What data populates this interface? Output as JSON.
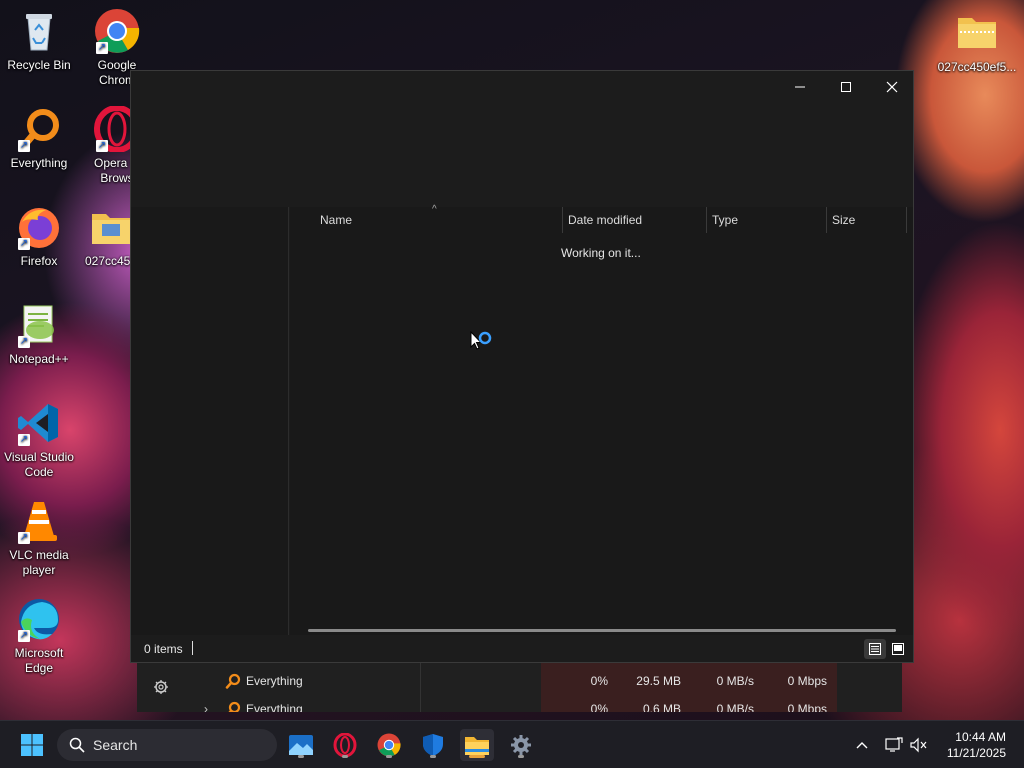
{
  "desktop": {
    "icons": [
      {
        "label": "Recycle Bin",
        "icon": "recycle-bin-icon"
      },
      {
        "label": "Google Chrome",
        "display": "Google\nChrom",
        "icon": "chrome-icon"
      },
      {
        "label": "Everything",
        "icon": "everything-icon"
      },
      {
        "label": "Opera GX Browser",
        "display": "Opera G\nBrows",
        "icon": "opera-icon"
      },
      {
        "label": "Firefox",
        "icon": "firefox-icon"
      },
      {
        "label": "027cc450",
        "display": "027cc450",
        "icon": "folder-icon"
      },
      {
        "label": "Notepad++",
        "icon": "notepadpp-icon"
      },
      {
        "label": "Visual Studio Code",
        "icon": "vscode-icon"
      },
      {
        "label": "VLC media player",
        "icon": "vlc-icon"
      },
      {
        "label": "Microsoft Edge",
        "icon": "edge-icon"
      },
      {
        "label": "027cc450ef5...",
        "icon": "zip-folder-icon"
      }
    ],
    "labels": {
      "recycle": "Recycle Bin",
      "chrome_1": "Google",
      "chrome_2": "Chrom",
      "everything": "Everything",
      "opera_1": "Opera G",
      "opera_2": "Brows",
      "firefox": "Firefox",
      "folder": "027cc450",
      "notepad": "Notepad++",
      "vscode_1": "Visual Studio",
      "vscode_2": "Code",
      "vlc_1": "VLC media",
      "vlc_2": "player",
      "edge_1": "Microsoft",
      "edge_2": "Edge",
      "zip": "027cc450ef5..."
    }
  },
  "explorer": {
    "columns": {
      "name": "Name",
      "date_modified": "Date modified",
      "type": "Type",
      "size": "Size"
    },
    "sort_indicator": "^",
    "loading_text": "Working on it...",
    "status": {
      "item_count": "0 items"
    }
  },
  "task_manager": {
    "rows": [
      {
        "name": "Everything",
        "cpu": "0%",
        "memory": "29.5 MB",
        "disk": "0 MB/s",
        "network": "0 Mbps"
      },
      {
        "name": "Everything",
        "cpu": "0%",
        "memory": "0.6 MB",
        "disk": "0 MB/s",
        "network": "0 Mbps"
      }
    ]
  },
  "taskbar": {
    "search_label": "Search",
    "pinned": [
      "photos-icon",
      "opera-icon",
      "chrome-icon",
      "defender-icon",
      "file-explorer-icon",
      "settings-icon"
    ],
    "clock": {
      "time": "10:44 AM",
      "date": "11/21/2025"
    }
  },
  "colors": {
    "accent": "#0f6cbd",
    "explorer_indicator": "#e8a23a",
    "window_bg": "#1c1c1c"
  }
}
